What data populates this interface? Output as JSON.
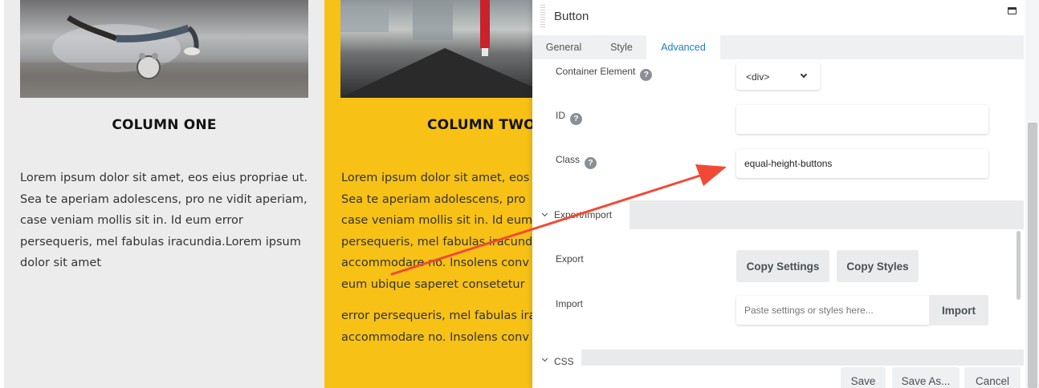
{
  "page": {
    "col_one": {
      "title": "COLUMN ONE",
      "text": "Lorem ipsum dolor sit amet, eos eius propriae ut. Sea te aperiam adolescens, pro ne vidit aperiam, case veniam mollis sit in. Id eum error persequeris, mel fabulas iracundia.Lorem ipsum dolor sit amet"
    },
    "col_two": {
      "title": "COLUMN TWO",
      "lines_a": [
        "Lorem ipsum dolor sit amet, eos",
        "Sea te aperiam adolescens, pro",
        "case veniam mollis sit in. Id eum",
        "persequeris, mel fabulas iracund",
        "accommodare no. Insolens conv",
        "eum ubique saperet consetetur"
      ],
      "lines_b": [
        "error persequeris, mel fabulas ira",
        "accommodare no. Insolens conv"
      ]
    },
    "colors": {
      "col_one_bg": "#ececed",
      "col_two_bg": "#f7c116"
    }
  },
  "panel": {
    "title": "Button",
    "tabs": {
      "general": "General",
      "style": "Style",
      "advanced": "Advanced"
    },
    "active_tab": "advanced",
    "fields": {
      "container_element": {
        "label": "Container Element",
        "value": "<div>"
      },
      "id": {
        "label": "ID",
        "value": ""
      },
      "class": {
        "label": "Class",
        "value": "equal-height-buttons"
      }
    },
    "sections": {
      "export_import": "Export/Import",
      "css": "CSS"
    },
    "export": {
      "label": "Export",
      "copy_settings": "Copy Settings",
      "copy_styles": "Copy Styles"
    },
    "import": {
      "label": "Import",
      "placeholder": "Paste settings or styles here...",
      "button": "Import"
    },
    "footer": {
      "save": "Save",
      "save_as": "Save As...",
      "cancel": "Cancel"
    },
    "help_glyph": "?",
    "accent_color": "#1d7fc0",
    "annotation_color": "#f04a36"
  }
}
